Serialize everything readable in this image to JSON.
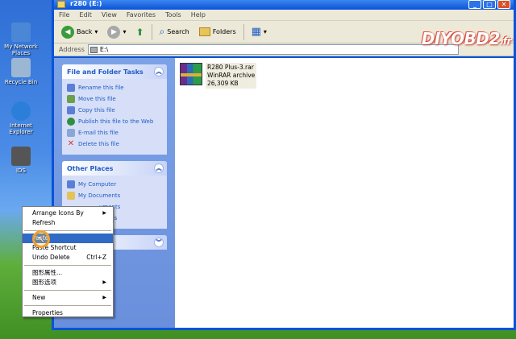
{
  "desktop": {
    "icons": [
      {
        "label": "My Network Places",
        "color": "#4a87d6"
      },
      {
        "label": "Recycle Bin",
        "color": "#9bb7d4"
      },
      {
        "label": "Internet Explorer",
        "color": "#2b7fd8"
      },
      {
        "label": "IDS",
        "color": "#555555"
      }
    ]
  },
  "window": {
    "title": "r280 (E:)",
    "min_glyph": "_",
    "max_glyph": "□",
    "close_glyph": "✕",
    "menu": [
      "File",
      "Edit",
      "View",
      "Favorites",
      "Tools",
      "Help"
    ],
    "toolbar": {
      "back": "Back",
      "back_glyph": "◀",
      "forward_glyph": "▶",
      "search": "Search",
      "folders": "Folders",
      "dropdown_glyph": "▾",
      "up_glyph": "⬆",
      "search_glyph": "⌕",
      "views_glyph": "▦"
    },
    "address": {
      "label": "Address",
      "value": "E:\\"
    }
  },
  "left_pane": {
    "file_tasks": {
      "title": "File and Folder Tasks",
      "chev_glyph": "︽",
      "items": [
        {
          "label": "Rename this file",
          "color": "#5b7fd6"
        },
        {
          "label": "Move this file",
          "color": "#6aa04a"
        },
        {
          "label": "Copy this file",
          "color": "#5b7fd6"
        },
        {
          "label": "Publish this file to the Web",
          "color": "#2f8f3f"
        },
        {
          "label": "E-mail this file",
          "color": "#8aa6d6"
        },
        {
          "label": "Delete this file",
          "color": "#d33a2a"
        }
      ]
    },
    "other_places": {
      "title": "Other Places",
      "chev_glyph": "︽",
      "items": [
        {
          "label": "My Computer",
          "color": "#5b7fd6"
        },
        {
          "label": "My Documents",
          "color": "#e3c25a"
        },
        {
          "label": "uments",
          "color": "#e3c25a"
        },
        {
          "label": "Places",
          "color": "#4a87d6"
        }
      ]
    },
    "details": {
      "chev_glyph": "︾"
    }
  },
  "files": [
    {
      "name": "R280 Plus-3.rar",
      "type": "WinRAR archive",
      "size": "26,309 KB"
    }
  ],
  "context_menu": {
    "submenu_glyph": "▶",
    "items": [
      {
        "label": "Arrange Icons By",
        "submenu": true
      },
      {
        "label": "Refresh"
      },
      {
        "sep": true
      },
      {
        "label": "Paste",
        "selected": true
      },
      {
        "label": "Paste Shortcut"
      },
      {
        "label": "Undo Delete",
        "shortcut": "Ctrl+Z"
      },
      {
        "sep": true
      },
      {
        "label": "图形属性..."
      },
      {
        "label": "图形选项",
        "submenu": true
      },
      {
        "sep": true
      },
      {
        "label": "New",
        "submenu": true
      },
      {
        "sep": true
      },
      {
        "label": "Properties"
      }
    ]
  },
  "brand": {
    "text": "DIYOBD2",
    "suffix": ".fr"
  }
}
